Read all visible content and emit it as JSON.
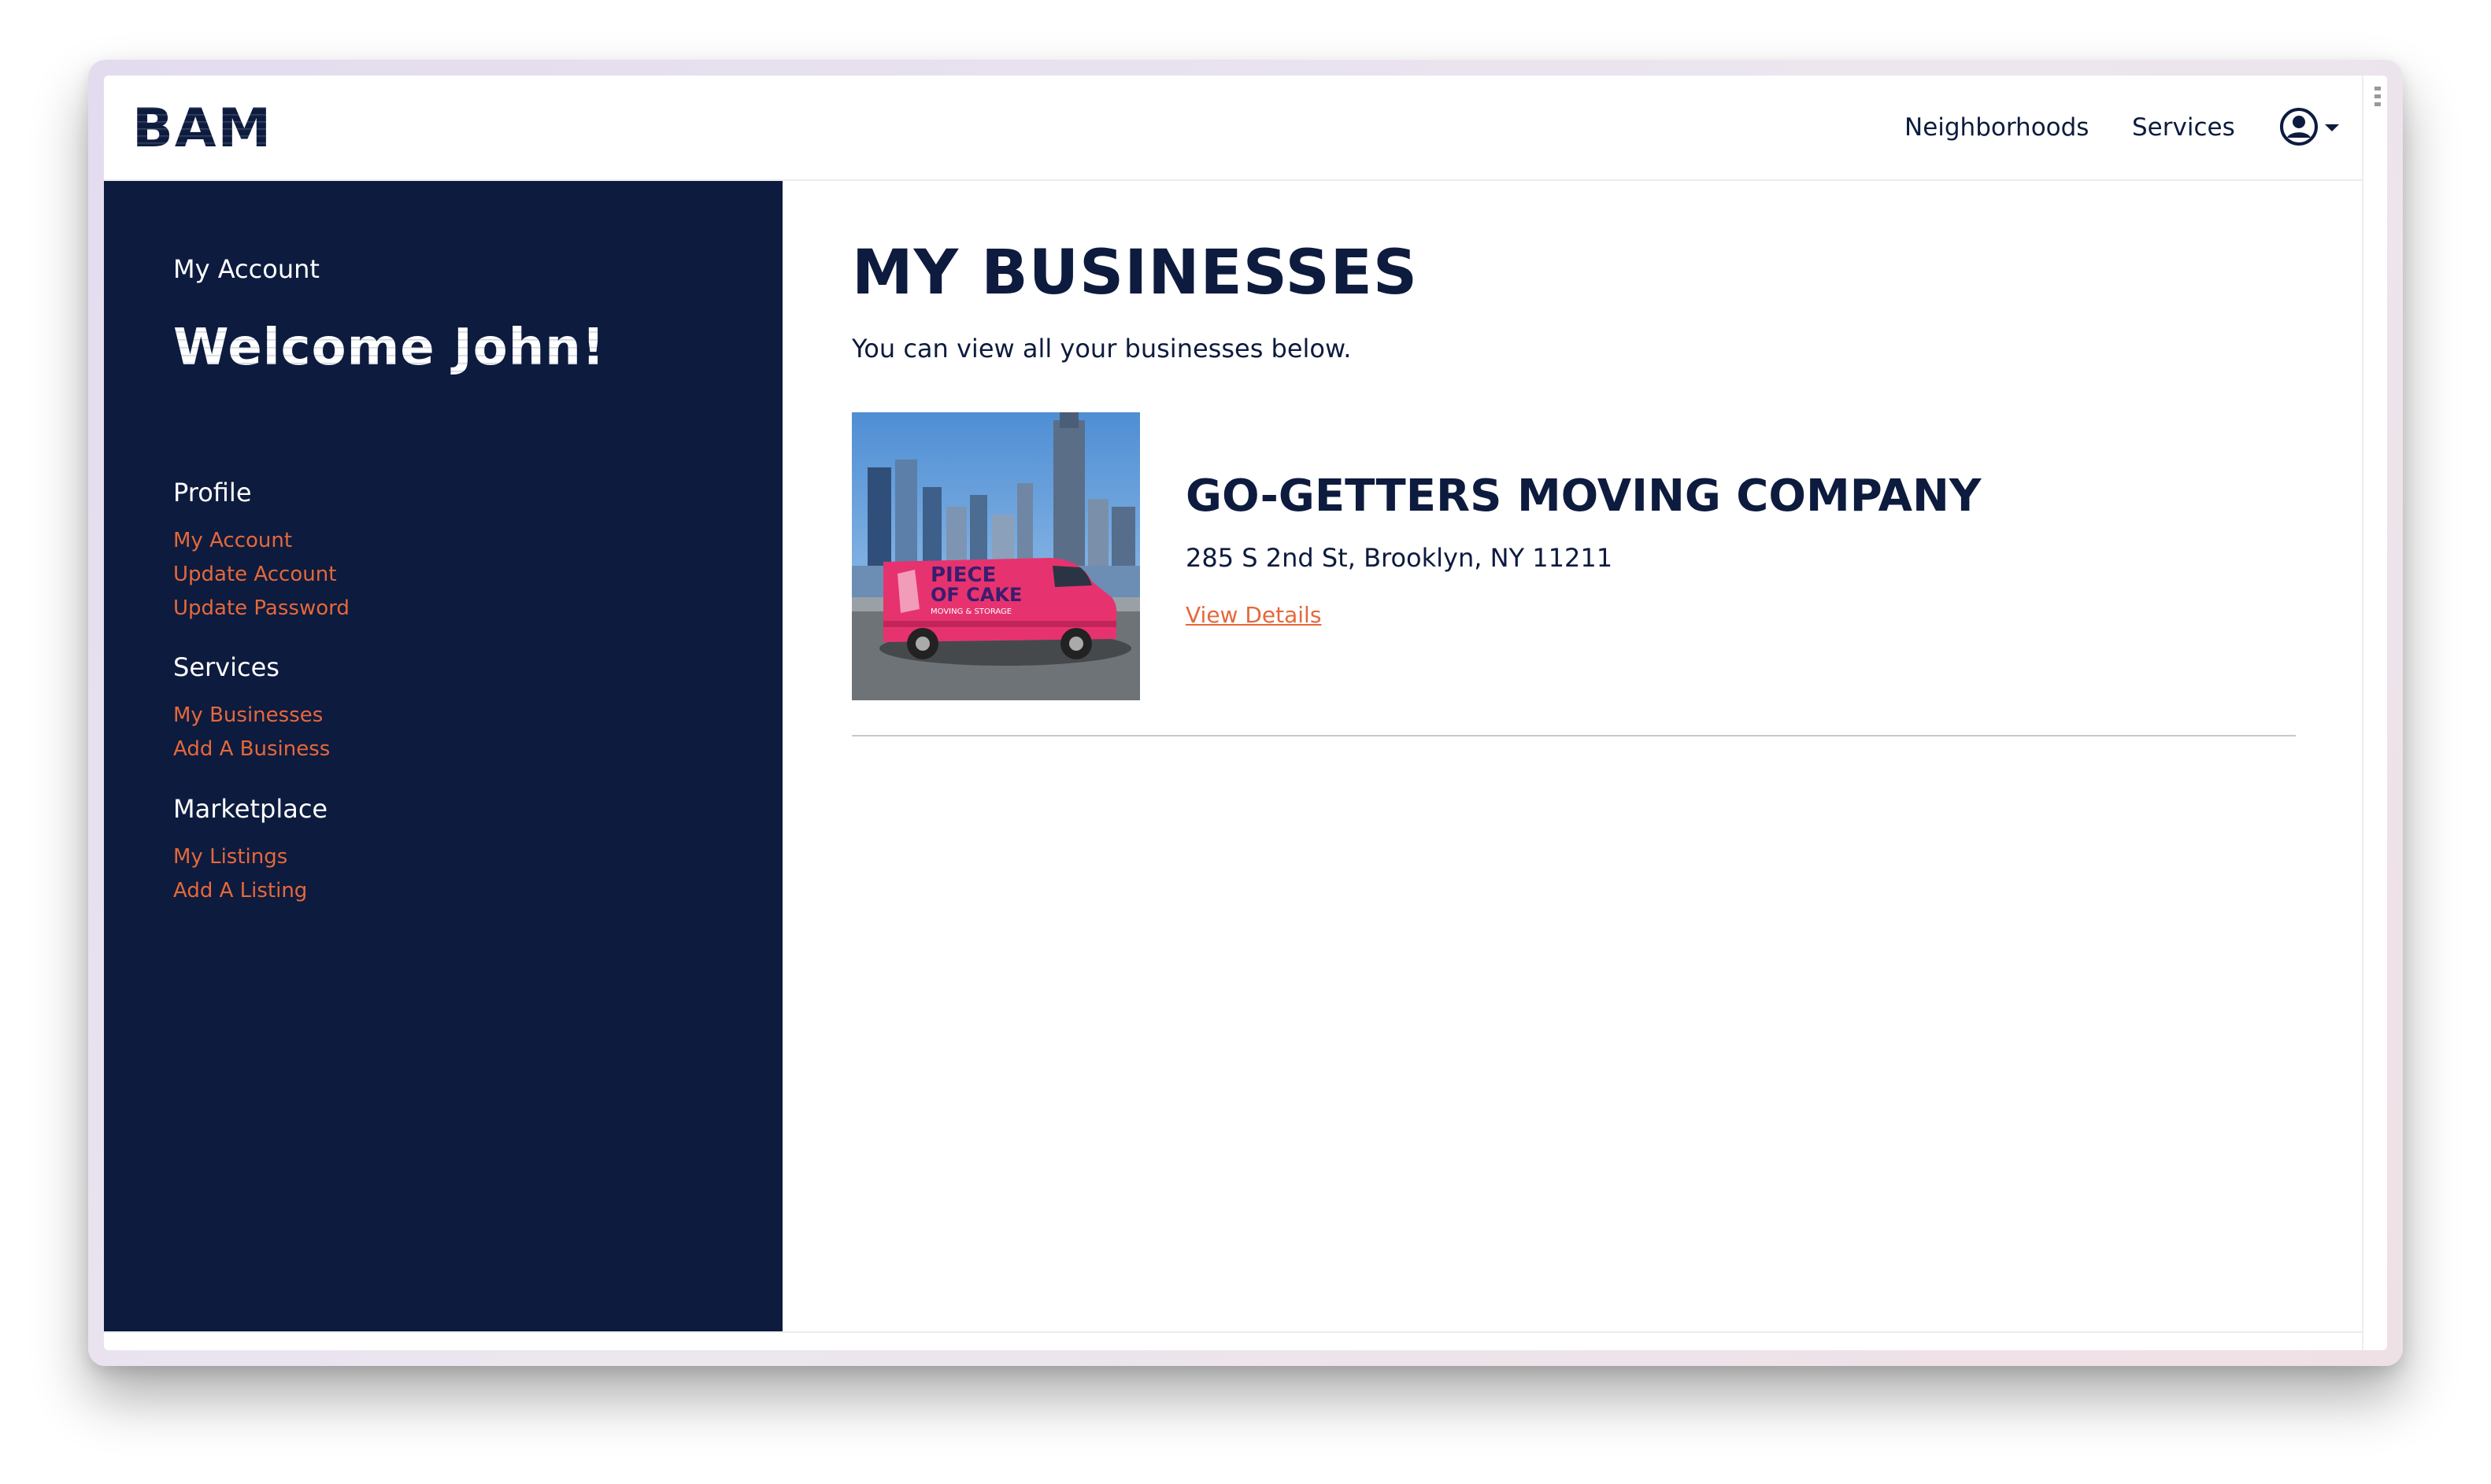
{
  "header": {
    "logo": "BAM",
    "nav": [
      {
        "label": "Neighborhoods"
      },
      {
        "label": "Services"
      }
    ]
  },
  "sidebar": {
    "subtitle": "My Account",
    "welcome": "Welcome John!",
    "sections": [
      {
        "title": "Profile",
        "links": [
          "My Account",
          "Update Account",
          "Update Password"
        ]
      },
      {
        "title": "Services",
        "links": [
          "My Businesses",
          "Add A Business"
        ]
      },
      {
        "title": "Marketplace",
        "links": [
          "My Listings",
          "Add A Listing"
        ]
      }
    ]
  },
  "main": {
    "title": "MY BUSINESSES",
    "description": "You can view all your businesses below.",
    "businesses": [
      {
        "name": "GO-GETTERS MOVING COMPANY",
        "address": "285 S 2nd St, Brooklyn, NY 11211",
        "link_label": "View Details",
        "image_text": [
          "PIECE",
          "OF CAKE",
          "MOVING & STORAGE"
        ]
      }
    ]
  },
  "colors": {
    "navy": "#0d1b3e",
    "accent_orange": "#e5683b",
    "van_pink": "#e6336f"
  },
  "icons": {
    "user": "user-circle-icon",
    "caret": "caret-down-icon"
  }
}
